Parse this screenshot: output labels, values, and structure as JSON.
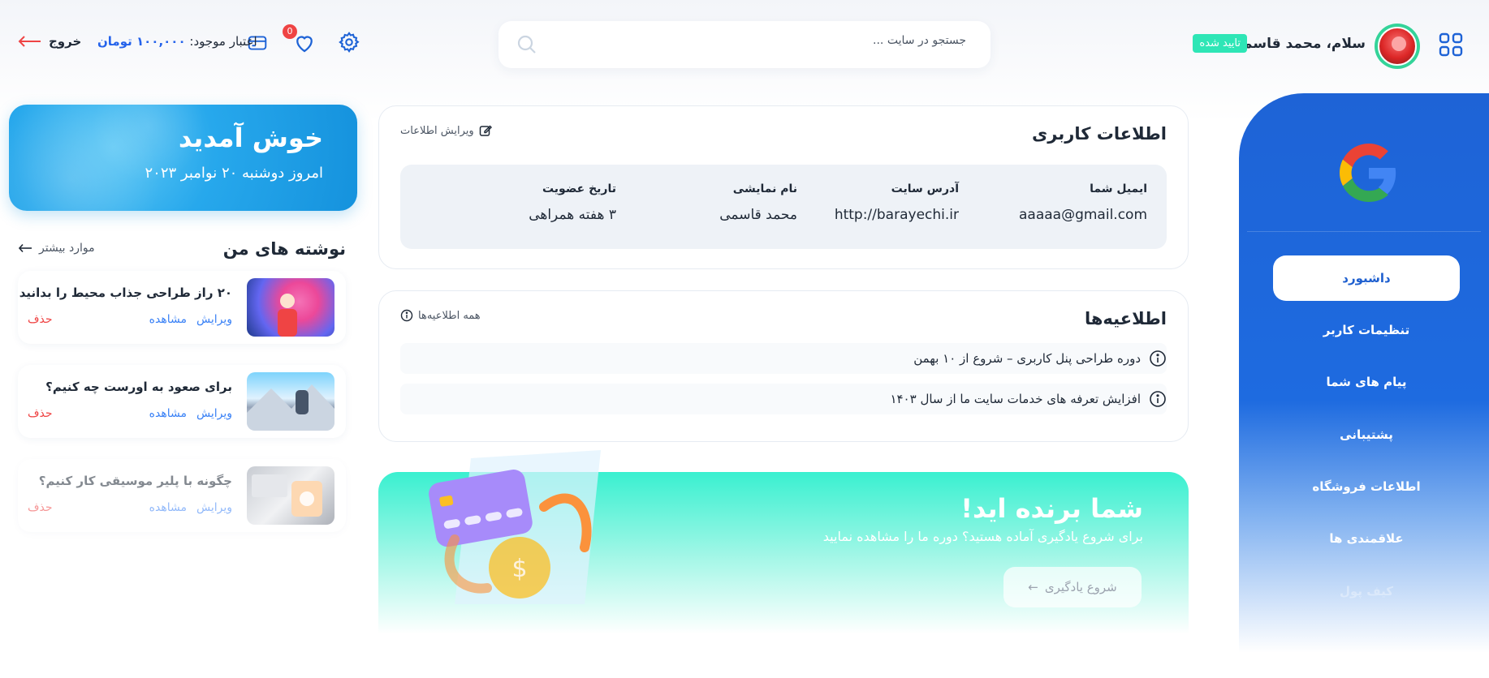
{
  "header": {
    "greeting": "سلام، محمد قاسمی",
    "verified": "تایید شده",
    "search_placeholder": "جستجو در سایت ...",
    "notifications_count": "0",
    "credit_label": "اعتبار موجود:",
    "credit_amount": "۱۰۰,۰۰۰ تومان",
    "logout": "خروج"
  },
  "sidebar": {
    "items": [
      {
        "label": "داشبورد",
        "active": true
      },
      {
        "label": "تنظیمات کاربر"
      },
      {
        "label": "پیام های شما"
      },
      {
        "label": "پشتیبانی"
      },
      {
        "label": "اطلاعات فروشگاه"
      },
      {
        "label": "علاقمندی ها"
      },
      {
        "label": "کیف پول"
      }
    ]
  },
  "user_info": {
    "title": "اطلاعات کاربری",
    "edit": "ویرایش اطلاعات",
    "fields": [
      {
        "label": "ایمیل شما",
        "value": "aaaaa@gmail.com"
      },
      {
        "label": "آدرس سایت",
        "value": "http://barayechi.ir"
      },
      {
        "label": "نام نمایشی",
        "value": "محمد قاسمی"
      },
      {
        "label": "تاریخ عضویت",
        "value": "۳ هفته همراهی"
      }
    ]
  },
  "notifications": {
    "title": "اطلاعیه‌ها",
    "all": "همه اطلاعیه‌ها",
    "items": [
      "دوره طراحی پنل کاربری – شروع از ۱۰ بهمن",
      "افزایش تعرفه های خدمات سایت ما از سال ۱۴۰۳"
    ]
  },
  "winner": {
    "title": "شما برنده اید!",
    "subtitle": "برای شروع یادگیری آماده هستید؟ دوره ما را مشاهده نمایید",
    "button": "شروع یادگیری"
  },
  "welcome": {
    "title": "خوش آمدید",
    "date": "امروز دوشنبه ۲۰ نوامبر ۲۰۲۳"
  },
  "posts": {
    "title": "نوشته های من",
    "more": "موارد بیشتر",
    "edit": "ویرایش",
    "view": "مشاهده",
    "delete": "حذف",
    "items": [
      {
        "title": "۲۰ راز طراحی جذاب محیط را بدانید",
        "thumb": "person-smoke"
      },
      {
        "title": "برای صعود به اورست چه کنیم؟",
        "thumb": "mountain"
      },
      {
        "title": "چگونه با پلیر موسیقی کار کنیم؟",
        "thumb": "music-player"
      }
    ]
  },
  "colors": {
    "primary": "#1e63d6",
    "accent": "#2ee6b6",
    "danger": "#ef4444",
    "link": "#3b82f6"
  }
}
